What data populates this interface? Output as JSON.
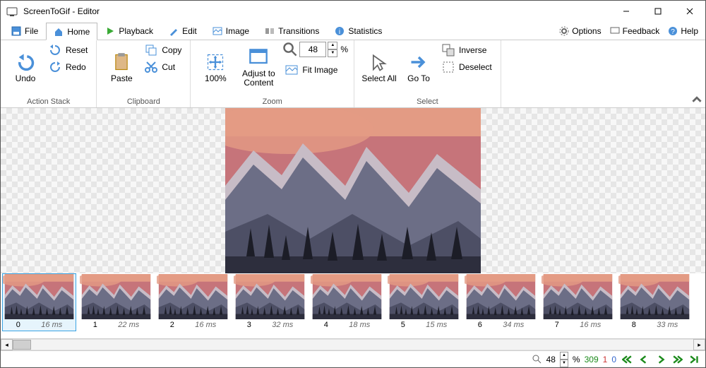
{
  "window": {
    "title": "ScreenToGif - Editor"
  },
  "tabs": {
    "file": "File",
    "home": "Home",
    "playback": "Playback",
    "edit": "Edit",
    "image": "Image",
    "transitions": "Transitions",
    "statistics": "Statistics"
  },
  "topright": {
    "options": "Options",
    "feedback": "Feedback",
    "help": "Help"
  },
  "ribbon": {
    "undo": "Undo",
    "redo": "Redo",
    "reset": "Reset",
    "action_stack": "Action Stack",
    "paste": "Paste",
    "copy": "Copy",
    "cut": "Cut",
    "clipboard": "Clipboard",
    "hundred": "100%",
    "adjust": "Adjust to Content",
    "zoom_value": "48",
    "percent": "%",
    "fit": "Fit Image",
    "zoom": "Zoom",
    "select_all": "Select All",
    "goto": "Go To",
    "inverse": "Inverse",
    "deselect": "Deselect",
    "select": "Select"
  },
  "thumbs": [
    {
      "idx": "0",
      "ms": "16 ms"
    },
    {
      "idx": "1",
      "ms": "22 ms"
    },
    {
      "idx": "2",
      "ms": "16 ms"
    },
    {
      "idx": "3",
      "ms": "32 ms"
    },
    {
      "idx": "4",
      "ms": "18 ms"
    },
    {
      "idx": "5",
      "ms": "15 ms"
    },
    {
      "idx": "6",
      "ms": "34 ms"
    },
    {
      "idx": "7",
      "ms": "16 ms"
    },
    {
      "idx": "8",
      "ms": "33 ms"
    }
  ],
  "status": {
    "zoom": "48",
    "percent": "%",
    "total": "309",
    "selected": "1",
    "clipboard": "0"
  }
}
